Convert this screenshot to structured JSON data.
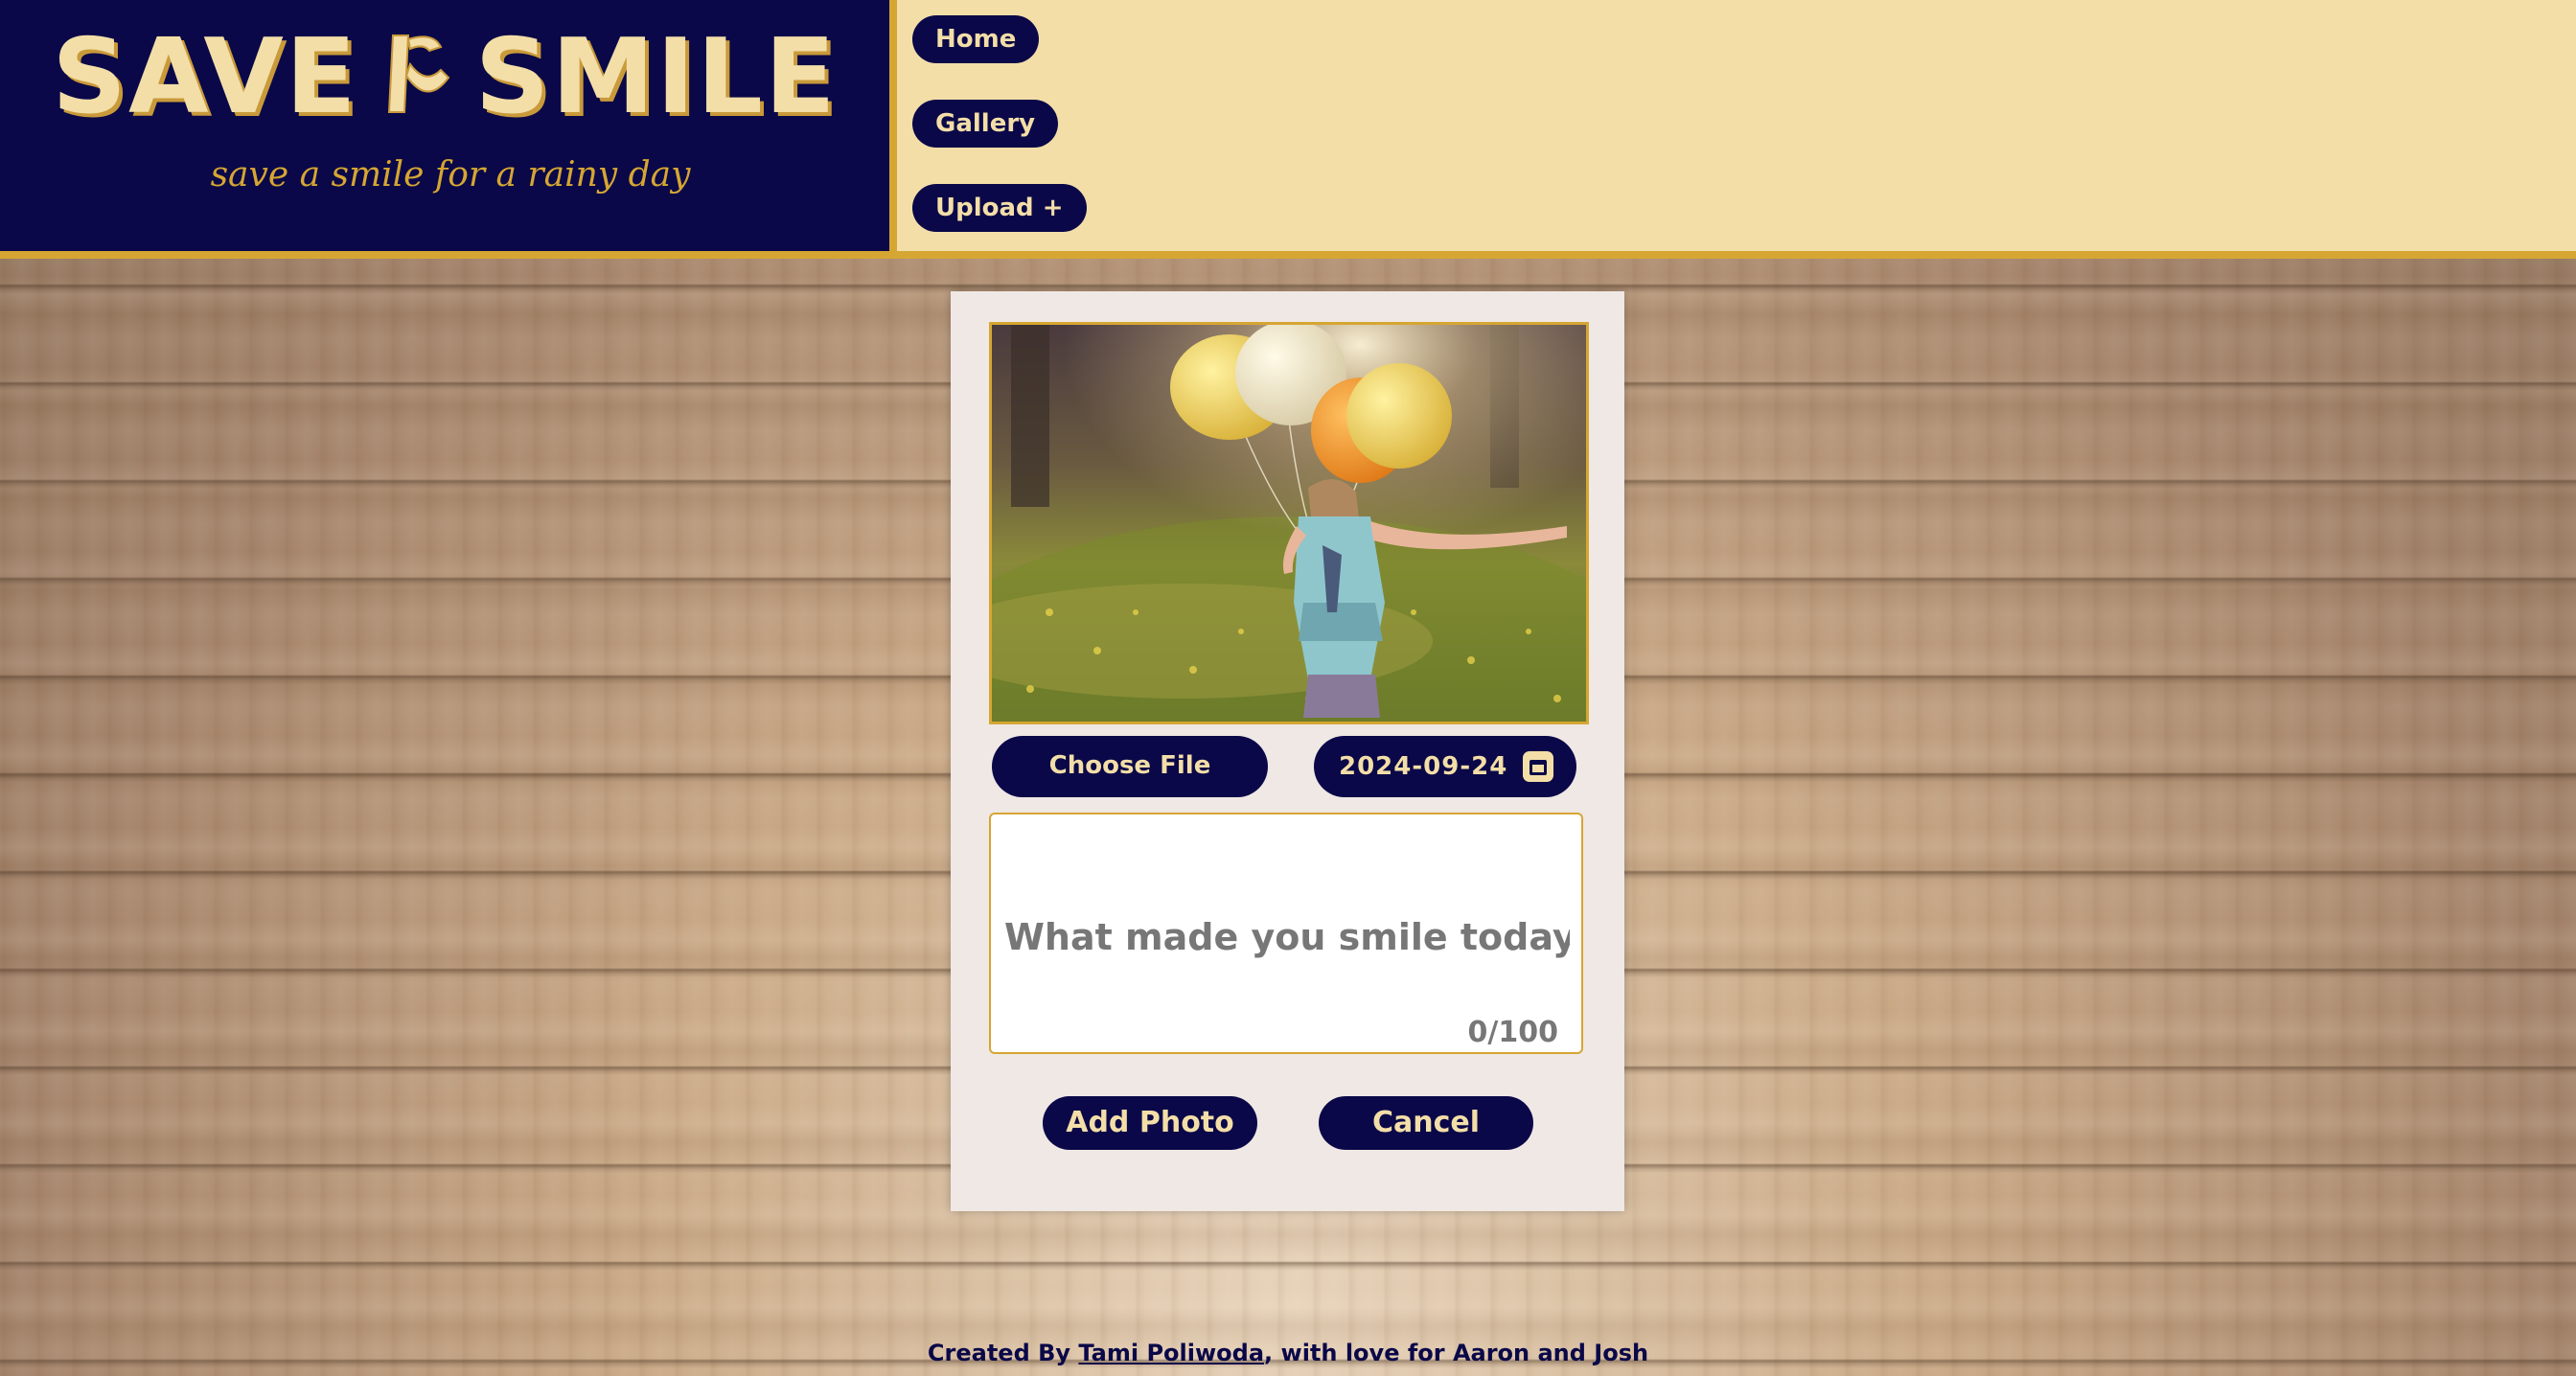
{
  "header": {
    "title_left": "SAVE",
    "title_right": "SMILE",
    "logo_icon": "smile-logo-icon",
    "tagline": "save a smile for a rainy day"
  },
  "nav": {
    "items": [
      {
        "label": "Home"
      },
      {
        "label": "Gallery"
      },
      {
        "label": "Upload +"
      }
    ]
  },
  "form": {
    "choose_file_label": "Choose File",
    "date_value": "2024-09-24",
    "date_icon": "calendar-icon",
    "caption_placeholder": "What made you smile today?",
    "char_count": "0/100",
    "add_button_label": "Add Photo",
    "cancel_button_label": "Cancel"
  },
  "footer": {
    "prefix": "Created By ",
    "author_link": "Tami Poliwoda",
    "suffix": ", with love for Aaron and Josh"
  },
  "colors": {
    "navy": "#0a0848",
    "cream": "#f3dea8",
    "gold": "#d6a633",
    "card_bg": "#efe8e4"
  }
}
